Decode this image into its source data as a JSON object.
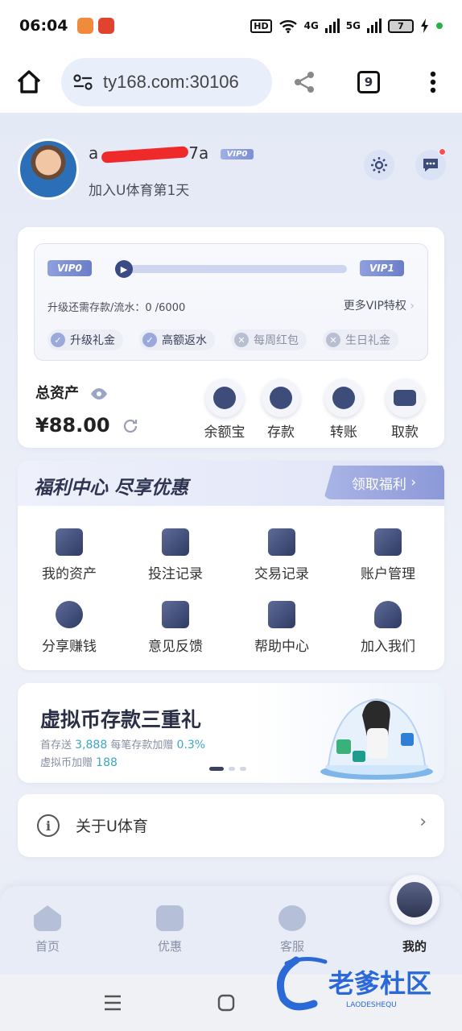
{
  "status_bar": {
    "time": "06:04",
    "network_4g": "4G",
    "network_5g": "5G",
    "hd": "HD",
    "battery": "7"
  },
  "browser": {
    "url": "ty168.com:30106",
    "tab_count": "9"
  },
  "profile": {
    "username_prefix": "a",
    "username_suffix": "7a",
    "vip_badge": "VIP0",
    "join_days": "加入U体育第1天"
  },
  "vip": {
    "current": "VIP0",
    "next": "VIP1",
    "progress": 0,
    "upgrade_text": "升级还需存款/流水：0 /6000",
    "more_link": "更多VIP特权",
    "perks": [
      {
        "label": "升级礼金",
        "enabled": true
      },
      {
        "label": "高额返水",
        "enabled": true
      },
      {
        "label": "每周红包",
        "enabled": false
      },
      {
        "label": "生日礼金",
        "enabled": false
      }
    ]
  },
  "assets": {
    "label": "总资产",
    "value": "¥88.00",
    "actions": [
      {
        "label": "余额宝"
      },
      {
        "label": "存款"
      },
      {
        "label": "转账"
      },
      {
        "label": "取款"
      }
    ]
  },
  "welfare": {
    "title": "福利中心 尽享优惠",
    "claim_button": "领取福利",
    "items": [
      {
        "label": "我的资产"
      },
      {
        "label": "投注记录"
      },
      {
        "label": "交易记录"
      },
      {
        "label": "账户管理"
      },
      {
        "label": "分享赚钱"
      },
      {
        "label": "意见反馈"
      },
      {
        "label": "帮助中心"
      },
      {
        "label": "加入我们"
      }
    ]
  },
  "promo": {
    "title": "虚拟币存款三重礼",
    "line1_a": "首存送",
    "line1_b": "3,888",
    "line1_c": "每笔存款加赠",
    "line1_d": "0.3%",
    "line2_a": "虚拟币加赠",
    "line2_b": "188",
    "slide_index": 1,
    "slide_count": 3
  },
  "about": {
    "label": "关于U体育"
  },
  "tabbar": {
    "tabs": [
      {
        "label": "首页"
      },
      {
        "label": "优惠"
      },
      {
        "label": "客服"
      },
      {
        "label": "我的"
      }
    ],
    "active": "我的"
  },
  "watermark": {
    "text": "老爹杜区",
    "subtext": "LAODESHEQU"
  },
  "colors": {
    "accent": "#7d8ed6",
    "dark": "#2e3550",
    "promo_value": "#3aa6c7",
    "notify": "#ff4c4c"
  },
  "icons": {
    "settings": "gear-icon",
    "messages": "chat-icon",
    "visibility": "eye-icon",
    "refresh": "refresh-icon",
    "about": "info-icon"
  }
}
